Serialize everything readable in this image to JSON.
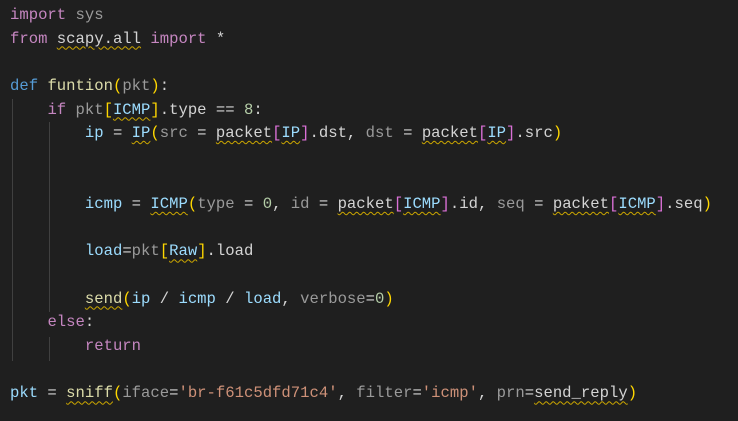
{
  "editor": {
    "lines": [
      [
        {
          "t": "import",
          "c": "kw"
        },
        {
          "t": " "
        },
        {
          "t": "sys",
          "c": "dim"
        }
      ],
      [
        {
          "t": "from",
          "c": "kw"
        },
        {
          "t": " "
        },
        {
          "t": "scapy.all",
          "c": "pl",
          "sq": true
        },
        {
          "t": " "
        },
        {
          "t": "import",
          "c": "kw"
        },
        {
          "t": " *",
          "c": "pl"
        }
      ],
      [],
      [
        {
          "t": "def",
          "c": "def"
        },
        {
          "t": " "
        },
        {
          "t": "funtion",
          "c": "fn"
        },
        {
          "t": "(",
          "c": "b1"
        },
        {
          "t": "pkt",
          "c": "dim"
        },
        {
          "t": ")",
          "c": "b1"
        },
        {
          "t": ":",
          "c": "pl"
        }
      ],
      [
        {
          "t": "    "
        },
        {
          "t": "if",
          "c": "kw"
        },
        {
          "t": " "
        },
        {
          "t": "pkt",
          "c": "dim"
        },
        {
          "t": "[",
          "c": "b1"
        },
        {
          "t": "ICMP",
          "c": "cls",
          "sq": true
        },
        {
          "t": "]",
          "c": "b1"
        },
        {
          "t": ".type == ",
          "c": "pl"
        },
        {
          "t": "8",
          "c": "num"
        },
        {
          "t": ":",
          "c": "pl"
        }
      ],
      [
        {
          "t": "        "
        },
        {
          "t": "ip",
          "c": "var"
        },
        {
          "t": " = ",
          "c": "pl"
        },
        {
          "t": "IP",
          "c": "cls",
          "sq": true
        },
        {
          "t": "(",
          "c": "b1"
        },
        {
          "t": "src",
          "c": "dim"
        },
        {
          "t": " = ",
          "c": "pl"
        },
        {
          "t": "packet",
          "c": "pl",
          "sq": true
        },
        {
          "t": "[",
          "c": "b2"
        },
        {
          "t": "IP",
          "c": "cls",
          "sq": true
        },
        {
          "t": "]",
          "c": "b2"
        },
        {
          "t": ".dst, ",
          "c": "pl"
        },
        {
          "t": "dst",
          "c": "dim"
        },
        {
          "t": " = ",
          "c": "pl"
        },
        {
          "t": "packet",
          "c": "pl",
          "sq": true
        },
        {
          "t": "[",
          "c": "b2"
        },
        {
          "t": "IP",
          "c": "cls",
          "sq": true
        },
        {
          "t": "]",
          "c": "b2"
        },
        {
          "t": ".src",
          "c": "pl"
        },
        {
          "t": ")",
          "c": "b1"
        }
      ],
      [],
      [],
      [
        {
          "t": "        "
        },
        {
          "t": "icmp",
          "c": "var"
        },
        {
          "t": " = ",
          "c": "pl"
        },
        {
          "t": "ICMP",
          "c": "cls",
          "sq": true
        },
        {
          "t": "(",
          "c": "b1"
        },
        {
          "t": "type",
          "c": "dim"
        },
        {
          "t": " = ",
          "c": "pl"
        },
        {
          "t": "0",
          "c": "num"
        },
        {
          "t": ", ",
          "c": "pl"
        },
        {
          "t": "id",
          "c": "dim"
        },
        {
          "t": " = ",
          "c": "pl"
        },
        {
          "t": "packet",
          "c": "pl",
          "sq": true
        },
        {
          "t": "[",
          "c": "b2"
        },
        {
          "t": "ICMP",
          "c": "cls",
          "sq": true
        },
        {
          "t": "]",
          "c": "b2"
        },
        {
          "t": ".id, ",
          "c": "pl"
        },
        {
          "t": "seq",
          "c": "dim"
        },
        {
          "t": " = ",
          "c": "pl"
        },
        {
          "t": "packet",
          "c": "pl",
          "sq": true
        },
        {
          "t": "[",
          "c": "b2"
        },
        {
          "t": "ICMP",
          "c": "cls",
          "sq": true
        },
        {
          "t": "]",
          "c": "b2"
        },
        {
          "t": ".seq",
          "c": "pl"
        },
        {
          "t": ")",
          "c": "b1"
        }
      ],
      [],
      [
        {
          "t": "        "
        },
        {
          "t": "load",
          "c": "var"
        },
        {
          "t": "=",
          "c": "pl"
        },
        {
          "t": "pkt",
          "c": "dim"
        },
        {
          "t": "[",
          "c": "b1"
        },
        {
          "t": "Raw",
          "c": "cls",
          "sq": true
        },
        {
          "t": "]",
          "c": "b1"
        },
        {
          "t": ".load",
          "c": "pl"
        }
      ],
      [],
      [
        {
          "t": "        "
        },
        {
          "t": "send",
          "c": "fn",
          "sq": true
        },
        {
          "t": "(",
          "c": "b1"
        },
        {
          "t": "ip",
          "c": "var"
        },
        {
          "t": " / ",
          "c": "pl"
        },
        {
          "t": "icmp",
          "c": "var"
        },
        {
          "t": " / ",
          "c": "pl"
        },
        {
          "t": "load",
          "c": "var"
        },
        {
          "t": ", ",
          "c": "pl"
        },
        {
          "t": "verbose",
          "c": "dim"
        },
        {
          "t": "=",
          "c": "pl"
        },
        {
          "t": "0",
          "c": "num"
        },
        {
          "t": ")",
          "c": "b1"
        }
      ],
      [
        {
          "t": "    "
        },
        {
          "t": "else",
          "c": "kw"
        },
        {
          "t": ":",
          "c": "pl"
        }
      ],
      [
        {
          "t": "        "
        },
        {
          "t": "return",
          "c": "kw"
        }
      ],
      [],
      [
        {
          "t": "pkt",
          "c": "var"
        },
        {
          "t": " = ",
          "c": "pl"
        },
        {
          "t": "sniff",
          "c": "fn",
          "sq": true
        },
        {
          "t": "(",
          "c": "b1"
        },
        {
          "t": "iface",
          "c": "dim"
        },
        {
          "t": "=",
          "c": "pl"
        },
        {
          "t": "'br-f61c5dfd71c4'",
          "c": "str"
        },
        {
          "t": ", ",
          "c": "pl"
        },
        {
          "t": "filter",
          "c": "dim"
        },
        {
          "t": "=",
          "c": "pl"
        },
        {
          "t": "'icmp'",
          "c": "str"
        },
        {
          "t": ", ",
          "c": "pl"
        },
        {
          "t": "prn",
          "c": "dim"
        },
        {
          "t": "=",
          "c": "pl"
        },
        {
          "t": "send_reply",
          "c": "pl",
          "sq": true
        },
        {
          "t": ")",
          "c": "b1"
        }
      ]
    ]
  }
}
